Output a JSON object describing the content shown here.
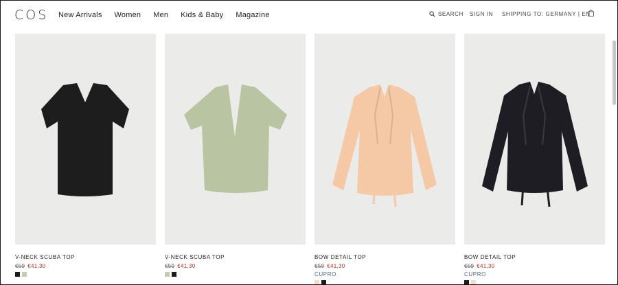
{
  "header": {
    "logo": "COS",
    "nav": [
      "New Arrivals",
      "Women",
      "Men",
      "Kids & Baby",
      "Magazine"
    ],
    "search_label": "SEARCH",
    "signin_label": "SIGN IN",
    "shipping_label": "SHIPPING TO: GERMANY | EN"
  },
  "products": [
    {
      "name": "V-NECK SCUBA TOP",
      "old_price": "€59",
      "new_price": "€41,30",
      "material": "",
      "swatches": [
        "#1a1a1a",
        "#c9c8b3"
      ],
      "garment_color": "#1d1d1d"
    },
    {
      "name": "V-NECK SCUBA TOP",
      "old_price": "€59",
      "new_price": "€41,30",
      "material": "",
      "swatches": [
        "#c9c8b3",
        "#1a1a1a"
      ],
      "garment_color": "#b9c4a2"
    },
    {
      "name": "BOW DETAIL TOP",
      "old_price": "€59",
      "new_price": "€41,30",
      "material": "CUPRO",
      "swatches": [
        "#f3dccb",
        "#1a1a1a"
      ],
      "garment_color": "#f6c9a6"
    },
    {
      "name": "BOW DETAIL TOP",
      "old_price": "€59",
      "new_price": "€41,30",
      "material": "CUPRO",
      "swatches": [
        "#1a1a1a",
        "#f3dccb"
      ],
      "garment_color": "#1e1d24"
    }
  ],
  "colors": {
    "sale_red": "#b33a2a",
    "material_blue": "#4a6a8a",
    "photo_bg": "#ebebe9"
  }
}
